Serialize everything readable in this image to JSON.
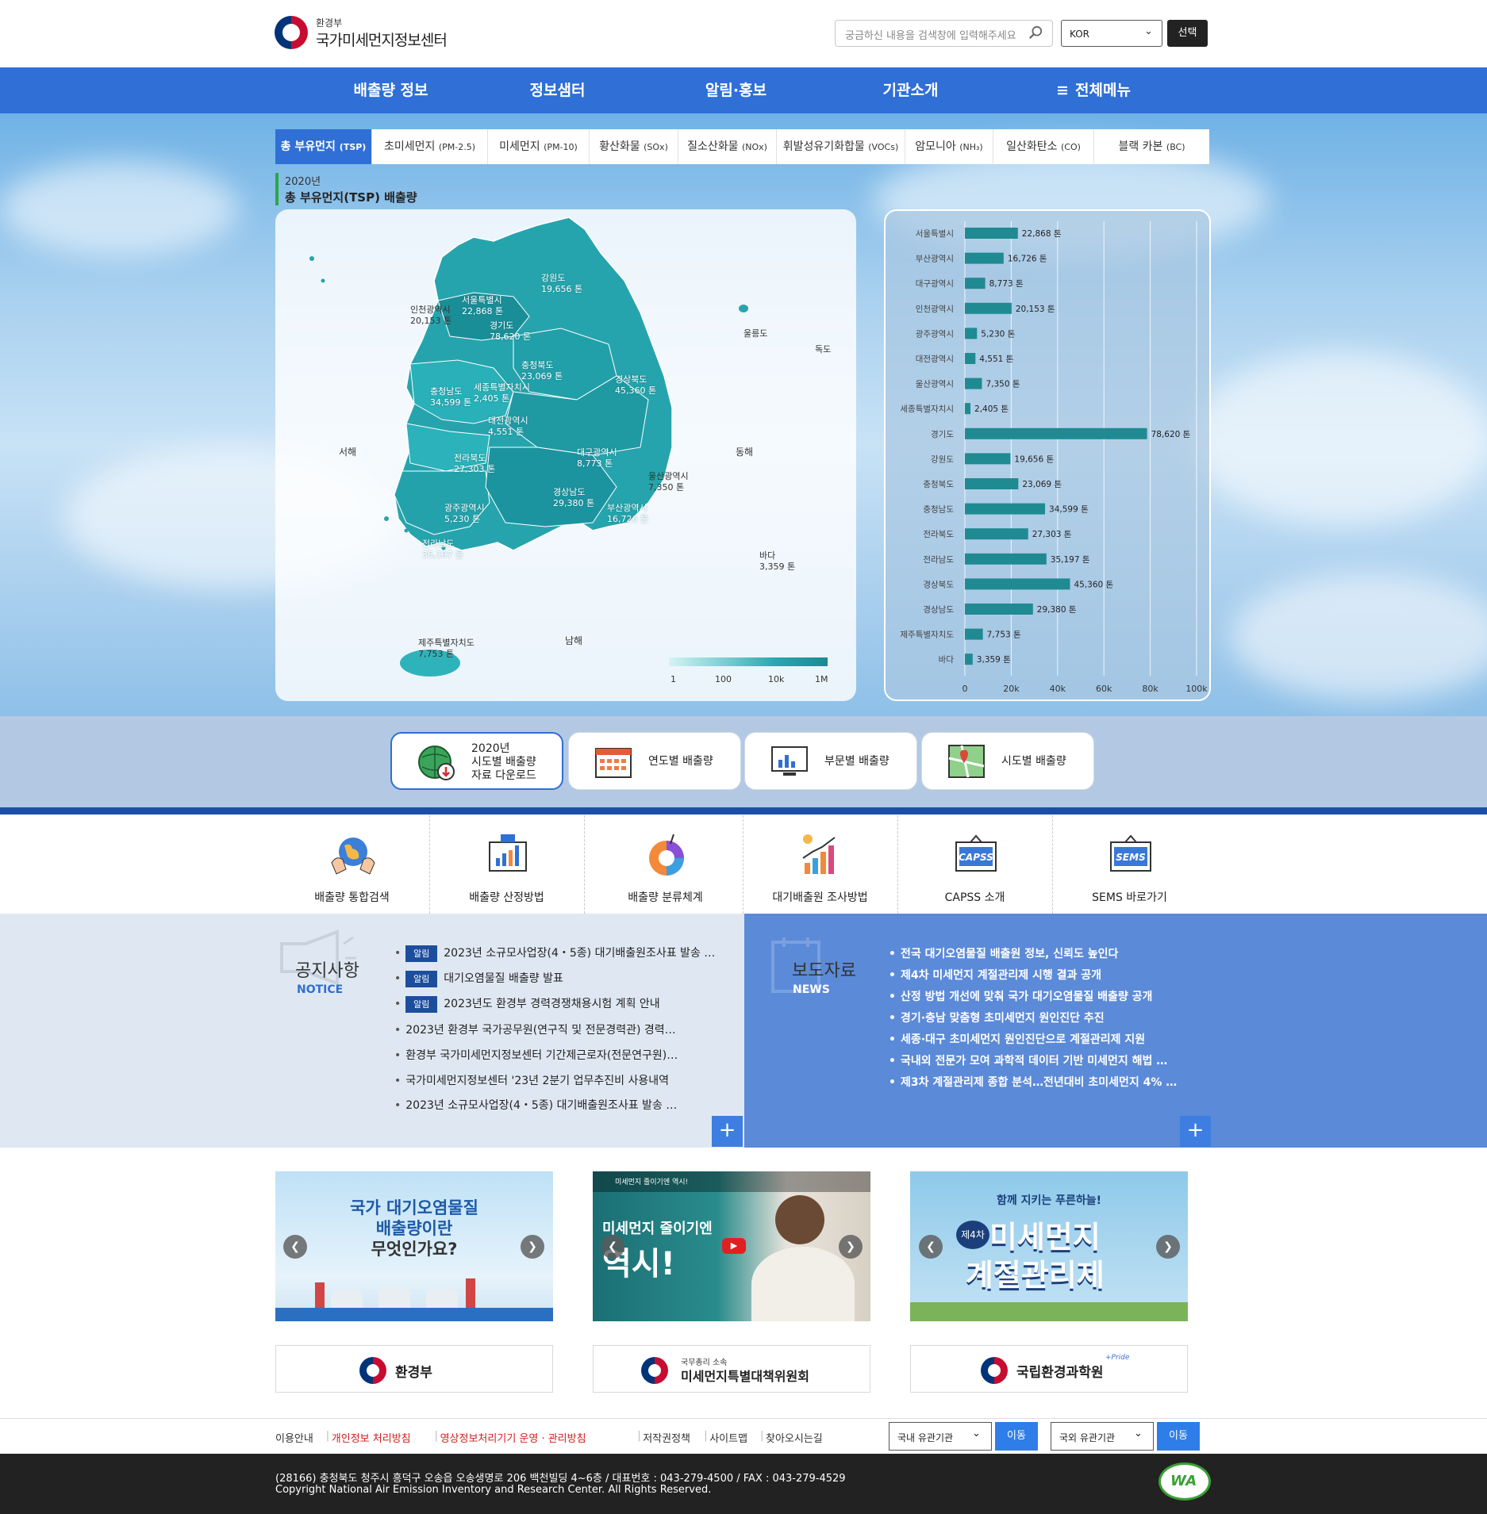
{
  "header": {
    "logo_sub": "환경부",
    "logo_title": "국가미세먼지정보센터",
    "search_placeholder": "궁금하신 내용을 검색창에 입력해주세요",
    "lang": "KOR",
    "select_label": "선택"
  },
  "gnb": [
    "배출량 정보",
    "정보샘터",
    "알림·홍보",
    "기관소개",
    "전체메뉴"
  ],
  "tabs": [
    {
      "label": "총 부유먼지",
      "code": "(TSP)"
    },
    {
      "label": "초미세먼지",
      "code": "(PM-2.5)"
    },
    {
      "label": "미세먼지",
      "code": "(PM-10)"
    },
    {
      "label": "황산화물",
      "code": "(SOx)"
    },
    {
      "label": "질소산화물",
      "code": "(NOx)"
    },
    {
      "label": "휘발성유기화합물",
      "code": "(VOCs)"
    },
    {
      "label": "암모니아",
      "code": "(NH₃)"
    },
    {
      "label": "일산화탄소",
      "code": "(CO)"
    },
    {
      "label": "블랙 카본",
      "code": "(BC)"
    }
  ],
  "year": "2020년",
  "heading": "총 부유먼지(TSP) 배출량",
  "map": {
    "labels": [
      {
        "name": "강원도",
        "value": "19,656 톤"
      },
      {
        "name": "서울특별시",
        "value": "22,868 톤"
      },
      {
        "name": "인천광역시",
        "value": "20,153 톤"
      },
      {
        "name": "경기도",
        "value": "78,620 톤"
      },
      {
        "name": "충청북도",
        "value": "23,069 톤"
      },
      {
        "name": "세종특별자치시",
        "value": "2,405 톤"
      },
      {
        "name": "충청남도",
        "value": "34,599 톤"
      },
      {
        "name": "경상북도",
        "value": "45,360 톤"
      },
      {
        "name": "대전광역시",
        "value": "4,551 톤"
      },
      {
        "name": "전라북도",
        "value": "27,303 톤"
      },
      {
        "name": "대구광역시",
        "value": "8,773 톤"
      },
      {
        "name": "울산광역시",
        "value": "7,350 톤"
      },
      {
        "name": "경상남도",
        "value": "29,380 톤"
      },
      {
        "name": "광주광역시",
        "value": "5,230 톤"
      },
      {
        "name": "부산광역시",
        "value": "16,726 톤"
      },
      {
        "name": "전라남도",
        "value": "35,197 톤"
      },
      {
        "name": "제주특별자치도",
        "value": "7,753 톤"
      },
      {
        "name": "바다",
        "value": "3,359 톤"
      }
    ],
    "seas": [
      "서해",
      "동해",
      "남해"
    ],
    "islands": [
      "울릉도",
      "독도"
    ],
    "legend": [
      "1",
      "100",
      "10k",
      "1M"
    ]
  },
  "chart_data": {
    "type": "bar",
    "orientation": "horizontal",
    "categories": [
      "서울특별시",
      "부산광역시",
      "대구광역시",
      "인천광역시",
      "광주광역시",
      "대전광역시",
      "울산광역시",
      "세종특별자치시",
      "경기도",
      "강원도",
      "충청북도",
      "충청남도",
      "전라북도",
      "전라남도",
      "경상북도",
      "경상남도",
      "제주특별자치도",
      "바다"
    ],
    "values": [
      22868,
      16726,
      8773,
      20153,
      5230,
      4551,
      7350,
      2405,
      78620,
      19656,
      23069,
      34599,
      27303,
      35197,
      45360,
      29380,
      7753,
      3359
    ],
    "value_labels": [
      "22,868 톤",
      "16,726 톤",
      "8,773 톤",
      "20,153 톤",
      "5,230 톤",
      "4,551 톤",
      "7,350 톤",
      "2,405 톤",
      "78,620 톤",
      "19,656 톤",
      "23,069 톤",
      "34,599 톤",
      "27,303 톤",
      "35,197 톤",
      "45,360 톤",
      "29,380 톤",
      "7,753 톤",
      "3,359 톤"
    ],
    "xlim": [
      0,
      100000
    ],
    "xticks": [
      "0",
      "20k",
      "40k",
      "60k",
      "80k",
      "100k"
    ],
    "bar_color": "#1f8a92",
    "grid": true
  },
  "quick": [
    {
      "label": "2020년\n시도별 배출량\n자료 다운로드"
    },
    {
      "label": "연도별 배출량"
    },
    {
      "label": "부문별 배출량"
    },
    {
      "label": "시도별 배출량"
    }
  ],
  "services": [
    "배출량 통합검색",
    "배출량 산정방법",
    "배출량 분류체계",
    "대기배출원 조사방법",
    "CAPSS 소개",
    "SEMS 바로가기"
  ],
  "notice": {
    "title": "공지사항",
    "sub": "NOTICE",
    "badge": "알림",
    "items": [
      {
        "badge": true,
        "text": "2023년 소규모사업장(4・5종) 대기배출원조사표 발송 …"
      },
      {
        "badge": true,
        "text": "대기오염물질 배출량 발표"
      },
      {
        "badge": true,
        "text": "2023년도 환경부 경력경쟁채용시험 계획 안내"
      },
      {
        "badge": false,
        "text": "2023년 환경부 국가공무원(연구직 및 전문경력관) 경력…"
      },
      {
        "badge": false,
        "text": "환경부 국가미세먼지정보센터 기간제근로자(전문연구원)…"
      },
      {
        "badge": false,
        "text": "국가미세먼지정보센터 '23년 2분기 업무추진비 사용내역"
      },
      {
        "badge": false,
        "text": "2023년 소규모사업장(4・5종) 대기배출원조사표 발송 …"
      }
    ]
  },
  "press": {
    "title": "보도자료",
    "sub": "NEWS",
    "items": [
      "전국 대기오염물질 배출원 정보, 신뢰도 높인다",
      "제4차 미세먼지 계절관리제 시행 결과 공개",
      "산정 방법 개선에 맞춰 국가 대기오염물질 배출량 공개",
      "경기·충남 맞춤형 초미세먼지 원인진단 추진",
      "세종·대구 초미세먼지 원인진단으로 계절관리제 지원",
      "국내외 전문가 모여 과학적 데이터 기반 미세먼지 해법 …",
      "제3차 계절관리제 종합 분석…전년대비 초미세먼지 4% …"
    ]
  },
  "banners": {
    "b1": {
      "title1": "국가 대기오염물질",
      "title2": "배출량이란",
      "title3": "무엇인가요?"
    },
    "b2": {
      "top": "미세먼지 줄이기엔 역시!",
      "big1": "미세먼지 줄이기엔",
      "big2": "역시!"
    },
    "b3": {
      "t1": "함께 지키는 푸른하늘!",
      "t2": "제4차",
      "t3": "미세먼지",
      "t4": "계절관리제"
    }
  },
  "orgs": [
    {
      "name": "환경부",
      "sub": ""
    },
    {
      "name": "미세먼지특별대책위원회",
      "sub": "국무총리 소속"
    },
    {
      "name": "국립환경과학원",
      "sub": "+Pride"
    }
  ],
  "footer_links": [
    {
      "text": "이용안내",
      "red": false
    },
    {
      "text": "개인정보 처리방침",
      "red": true
    },
    {
      "text": "영상정보처리기기 운영 · 관리방침",
      "red": true
    },
    {
      "text": "저작권정책",
      "red": false
    },
    {
      "text": "사이트맵",
      "red": false
    },
    {
      "text": "찾아오시는길",
      "red": false
    }
  ],
  "footer_selects": {
    "domestic": "국내 유관기관",
    "foreign": "국외 유관기관",
    "go": "이동"
  },
  "footer": {
    "address": "(28166) 충청북도 청주시 흥덕구 오송읍 오송생명로 206 백천빌딩 4~6층 / 대표번호 : 043-279-4500 / FAX : 043-279-4529",
    "copyright": "Copyright National Air Emission Inventory and Research Center. All Rights Reserved."
  },
  "colors": {
    "primary": "#2f6fd6",
    "bar": "#1f8a92",
    "map": "#27a3ac",
    "press_bg": "#5b8ad8",
    "notice_bg": "#dfe8f2",
    "badge": "#1d4e9e"
  }
}
